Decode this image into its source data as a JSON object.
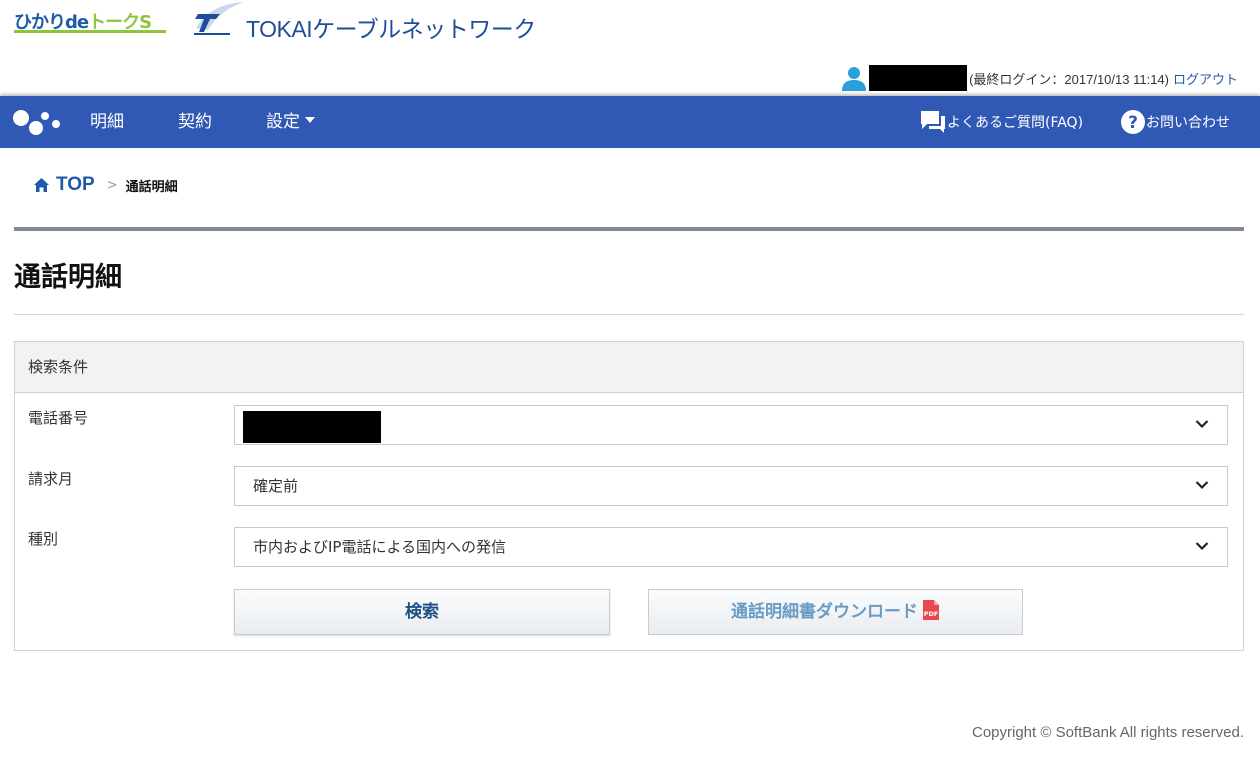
{
  "brand": {
    "hikari_part1": "ひかりde",
    "hikari_part2": "トークS",
    "tokai_name": "TOKAIケーブルネットワーク"
  },
  "user_bar": {
    "last_login": "(最終ログイン：2017/10/13 11:14)",
    "logout": "ログアウト"
  },
  "nav": {
    "items": [
      "明細",
      "契約",
      "設定"
    ],
    "faq": "よくあるご質問(FAQ)",
    "contact": "お問い合わせ"
  },
  "breadcrumb": {
    "top": "TOP",
    "separator": ">",
    "current": "通話明細"
  },
  "page": {
    "title": "通話明細"
  },
  "search": {
    "header": "検索条件",
    "fields": [
      {
        "label": "電話番号",
        "value": ""
      },
      {
        "label": "請求月",
        "value": "確定前"
      },
      {
        "label": "種別",
        "value": "市内およびIP電話による国内への発信"
      }
    ],
    "search_button": "検索",
    "download_button": "通話明細書ダウンロード"
  },
  "footer": {
    "copyright": "Copyright © SoftBank All rights reserved."
  },
  "colors": {
    "nav_bg": "#3058b5",
    "link": "#1f5aa8",
    "hikari_green": "#8cc63f"
  }
}
